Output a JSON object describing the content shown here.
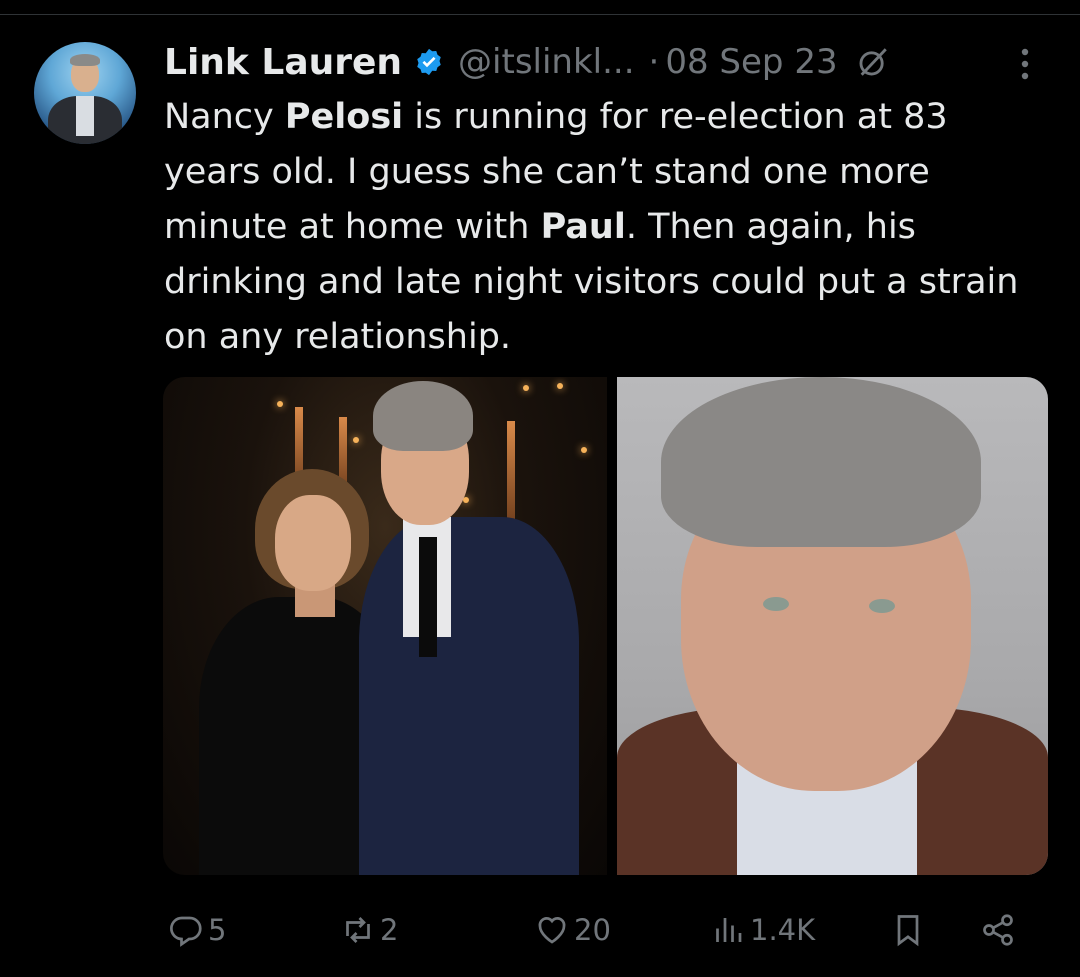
{
  "tweet": {
    "author": {
      "display_name": "Link Lauren",
      "handle": "@itslinkl...",
      "verified": true
    },
    "separator": "·",
    "date": "08 Sep 23",
    "text": {
      "p1": "Nancy ",
      "b1": "Pelosi",
      "p2": " is running for re-election at 83 years old. I guess she can’t stand one more minute at home with ",
      "b2": "Paul",
      "p3": ". Then again, his drinking and late night visitors could put a strain on any relationship."
    },
    "actions": {
      "replies": "5",
      "reposts": "2",
      "likes": "20",
      "views": "1.4K"
    }
  },
  "colors": {
    "background": "#000000",
    "text": "#e7e9ea",
    "secondary": "#71767b",
    "verified": "#1d9bf0",
    "divider": "#2f3336"
  },
  "icons": {
    "verified": "verified-badge-icon",
    "grok": "grok-icon",
    "more": "more-vertical-icon",
    "reply": "reply-icon",
    "repost": "repost-icon",
    "like": "heart-icon",
    "views": "analytics-icon",
    "bookmark": "bookmark-icon",
    "share": "share-icon"
  }
}
